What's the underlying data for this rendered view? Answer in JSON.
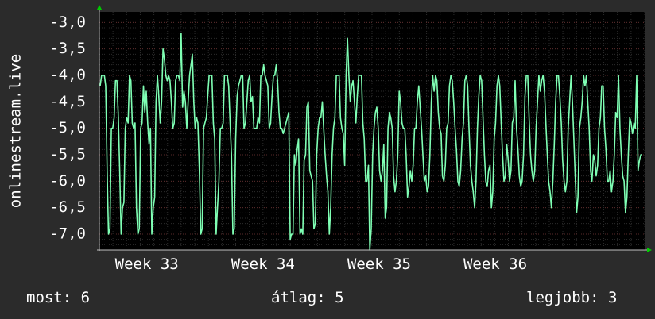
{
  "chart_data": {
    "type": "line",
    "ylabel": "onlinestream.live",
    "yticks": [
      "-3,0",
      "-3,5",
      "-4,0",
      "-4,5",
      "-5,0",
      "-5,5",
      "-6,0",
      "-6,5",
      "-7,0"
    ],
    "ytick_values": [
      -3.0,
      -3.5,
      -4.0,
      -4.5,
      -5.0,
      -5.5,
      -6.0,
      -6.5,
      -7.0
    ],
    "ylim": [
      -7.3,
      -2.8
    ],
    "xticks": [
      "Week 33",
      "Week 34",
      "Week 35",
      "Week 36"
    ],
    "xtick_positions": [
      0.087,
      0.3,
      0.513,
      0.726
    ],
    "grid": true,
    "colors": {
      "line": "#7fffb4",
      "background": "#000000",
      "grid_minor": "#2c2c2c",
      "grid_major": "#5a2a2a",
      "axis": "#c0c0c0",
      "arrow": "#00cc00"
    },
    "values": [
      -4.2,
      -4.0,
      -4.0,
      -4.0,
      -4.2,
      -5.8,
      -7.0,
      -6.9,
      -5.0,
      -5.0,
      -4.8,
      -4.1,
      -4.1,
      -4.8,
      -5.8,
      -7.0,
      -6.5,
      -6.4,
      -5.0,
      -4.8,
      -4.9,
      -4.0,
      -4.1,
      -4.9,
      -5.0,
      -4.9,
      -6.5,
      -7.0,
      -6.9,
      -5.0,
      -4.9,
      -4.2,
      -4.7,
      -4.3,
      -4.9,
      -5.3,
      -5.0,
      -7.0,
      -6.5,
      -6.3,
      -4.5,
      -4.0,
      -4.4,
      -4.9,
      -4.5,
      -3.5,
      -3.7,
      -4.0,
      -4.1,
      -4.0,
      -4.1,
      -4.5,
      -5.0,
      -4.9,
      -4.1,
      -4.0,
      -4.0,
      -4.1,
      -3.2,
      -4.6,
      -4.3,
      -4.5,
      -5.0,
      -4.5,
      -4.0,
      -3.8,
      -3.6,
      -4.5,
      -5.0,
      -4.8,
      -4.9,
      -5.8,
      -7.0,
      -6.9,
      -5.0,
      -4.9,
      -4.8,
      -4.4,
      -4.0,
      -4.0,
      -4.0,
      -4.9,
      -5.2,
      -7.0,
      -6.5,
      -6.0,
      -5.0,
      -5.0,
      -4.9,
      -4.0,
      -4.0,
      -4.0,
      -4.2,
      -4.9,
      -5.5,
      -7.0,
      -6.9,
      -5.2,
      -4.4,
      -4.2,
      -4.1,
      -4.0,
      -4.0,
      -5.0,
      -4.9,
      -4.5,
      -4.1,
      -4.0,
      -4.5,
      -4.4,
      -5.0,
      -5.0,
      -5.0,
      -4.8,
      -4.9,
      -4.0,
      -4.0,
      -3.8,
      -4.0,
      -4.1,
      -4.2,
      -5.0,
      -4.9,
      -4.4,
      -4.0,
      -4.0,
      -3.8,
      -4.1,
      -4.7,
      -5.0,
      -5.0,
      -5.1,
      -5.0,
      -4.9,
      -4.8,
      -4.7,
      -7.1,
      -7.0,
      -7.0,
      -5.5,
      -5.7,
      -5.4,
      -5.2,
      -7.0,
      -6.9,
      -7.0,
      -5.6,
      -5.5,
      -4.6,
      -4.5,
      -5.8,
      -5.9,
      -6.0,
      -6.9,
      -6.8,
      -5.5,
      -5.0,
      -4.8,
      -4.8,
      -4.5,
      -5.0,
      -5.5,
      -5.9,
      -6.2,
      -7.0,
      -6.5,
      -5.5,
      -5.0,
      -4.8,
      -4.0,
      -4.0,
      -4.0,
      -4.8,
      -5.0,
      -5.1,
      -5.7,
      -4.0,
      -3.3,
      -4.0,
      -4.5,
      -4.2,
      -4.1,
      -4.5,
      -4.9,
      -4.4,
      -4.0,
      -4.0,
      -4.0,
      -4.9,
      -5.2,
      -6.0,
      -6.0,
      -5.7,
      -7.3,
      -6.9,
      -5.5,
      -5.0,
      -4.7,
      -4.6,
      -5.0,
      -5.8,
      -6.0,
      -5.8,
      -5.3,
      -6.7,
      -6.5,
      -5.0,
      -4.7,
      -4.8,
      -5.0,
      -5.9,
      -6.2,
      -6.0,
      -5.5,
      -4.3,
      -4.5,
      -4.9,
      -5.0,
      -5.0,
      -5.5,
      -6.3,
      -6.1,
      -5.8,
      -6.0,
      -5.7,
      -5.0,
      -5.0,
      -4.5,
      -4.2,
      -4.6,
      -5.0,
      -5.5,
      -6.0,
      -5.9,
      -6.2,
      -6.1,
      -5.5,
      -4.5,
      -4.0,
      -4.3,
      -4.0,
      -4.1,
      -4.7,
      -5.0,
      -5.1,
      -5.9,
      -6.0,
      -5.7,
      -5.0,
      -4.9,
      -4.2,
      -4.0,
      -4.1,
      -4.5,
      -5.0,
      -5.4,
      -6.0,
      -6.1,
      -5.8,
      -5.2,
      -4.9,
      -4.1,
      -4.0,
      -4.2,
      -5.0,
      -5.7,
      -6.0,
      -6.2,
      -6.5,
      -6.0,
      -5.0,
      -4.4,
      -4.0,
      -4.1,
      -4.8,
      -5.5,
      -6.0,
      -6.1,
      -5.8,
      -5.7,
      -6.5,
      -6.2,
      -5.2,
      -4.9,
      -4.2,
      -4.0,
      -4.2,
      -4.9,
      -5.5,
      -6.0,
      -5.9,
      -5.3,
      -5.6,
      -6.0,
      -5.8,
      -4.9,
      -4.8,
      -4.1,
      -5.0,
      -5.4,
      -5.9,
      -6.1,
      -6.0,
      -5.5,
      -4.4,
      -4.0,
      -4.0,
      -4.8,
      -5.5,
      -5.8,
      -6.0,
      -5.8,
      -5.0,
      -4.5,
      -4.0,
      -4.3,
      -4.1,
      -4.0,
      -4.3,
      -4.9,
      -5.5,
      -6.0,
      -6.2,
      -6.5,
      -6.0,
      -5.3,
      -4.5,
      -4.0,
      -4.0,
      -4.4,
      -4.9,
      -5.6,
      -6.0,
      -6.2,
      -6.0,
      -5.0,
      -4.5,
      -4.0,
      -4.5,
      -5.2,
      -5.9,
      -6.6,
      -6.3,
      -5.0,
      -4.8,
      -4.5,
      -4.0,
      -4.2,
      -4.0,
      -4.5,
      -5.0,
      -5.8,
      -6.0,
      -5.5,
      -5.6,
      -5.9,
      -5.7,
      -5.0,
      -4.8,
      -4.2,
      -4.2,
      -5.0,
      -5.4,
      -6.0,
      -6.0,
      -5.8,
      -6.2,
      -6.0,
      -5.5,
      -4.7,
      -4.8,
      -4.0,
      -5.0,
      -5.5,
      -5.9,
      -6.0,
      -6.6,
      -6.3,
      -5.5,
      -4.8,
      -4.9,
      -5.1,
      -4.9,
      -5.0,
      -4.0,
      -5.8,
      -5.6,
      -5.5,
      -5.5
    ]
  },
  "footer": {
    "now": "most: 6",
    "avg": "átlag: 5",
    "best": "legjobb: 3"
  }
}
